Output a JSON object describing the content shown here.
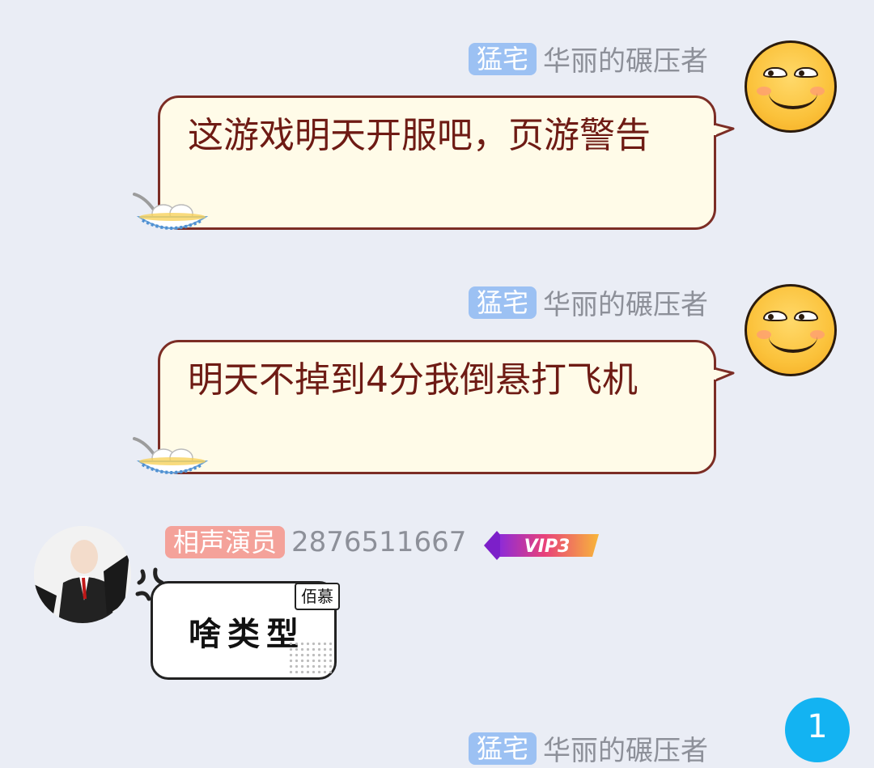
{
  "messages": [
    {
      "tag": "猛宅",
      "nickname": "华丽的碾压者",
      "text": "这游戏明天开服吧，页游警告",
      "avatar_icon": "laughing-face-icon"
    },
    {
      "tag": "猛宅",
      "nickname": "华丽的碾压者",
      "text": "明天不掉到4分我倒悬打飞机",
      "avatar_icon": "laughing-face-icon"
    },
    {
      "tag": "相声演员",
      "qq": "2876511667",
      "vip_label": "VIP3",
      "sticker_text": "啥类型",
      "sticker_tag": "佰慕"
    },
    {
      "tag": "猛宅",
      "nickname": "华丽的碾压者"
    }
  ],
  "unread_badge": "1",
  "colors": {
    "background": "#eaedf5",
    "title_tag_blue": "#9cc1f3",
    "title_tag_red": "#f4a29a",
    "bubble_fill": "#fffbe8",
    "bubble_border": "#7c2d25",
    "bubble_text": "#6e1b14",
    "badge": "#13b3f2"
  }
}
